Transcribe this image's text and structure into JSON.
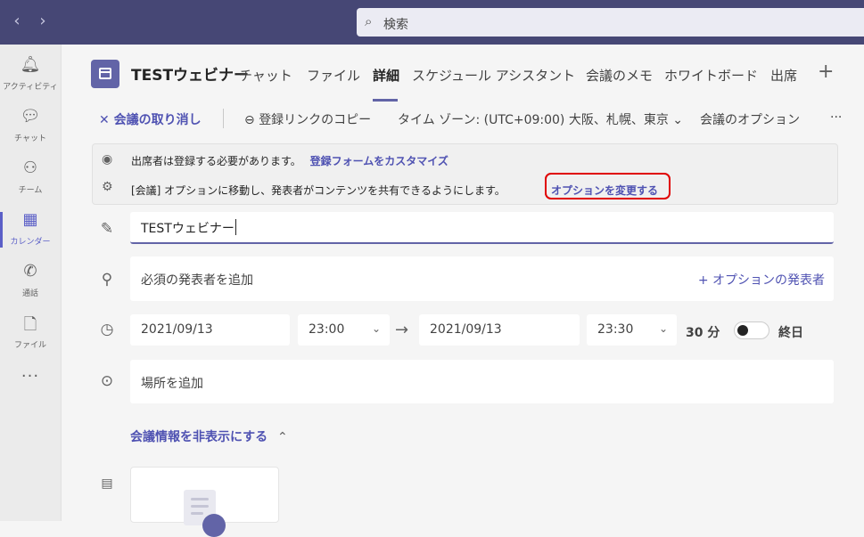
{
  "top_bar": {
    "back_icon": "chevron-left-icon",
    "forward_icon": "chevron-right-icon",
    "search_placeholder": "検索"
  },
  "rail": {
    "items": [
      {
        "label": "アクティビティ",
        "icon": "bell-icon"
      },
      {
        "label": "チャット",
        "icon": "chat-icon"
      },
      {
        "label": "チーム",
        "icon": "teams-icon"
      },
      {
        "label": "カレンダー",
        "icon": "calendar-icon"
      },
      {
        "label": "通話",
        "icon": "phone-icon"
      },
      {
        "label": "ファイル",
        "icon": "file-icon"
      }
    ],
    "active_index": 3,
    "more": "···"
  },
  "header": {
    "title": "TESTウェビナー",
    "tabs": [
      "チャット",
      "ファイル",
      "詳細",
      "スケジュール アシスタント",
      "会議のメモ",
      "ホワイトボード",
      "出席"
    ],
    "active_tab": "詳細",
    "add_tab": "+"
  },
  "actions": {
    "cancel": "会議の取り消し",
    "copy_link": "登録リンクのコピー",
    "timezone": "タイム ゾーン: (UTC+09:00) 大阪、札幌、東京",
    "meeting_options": "会議のオプション",
    "more": "···"
  },
  "banner": {
    "line1_text": "出席者は登録する必要があります。",
    "line1_link": "登録フォームをカスタマイズ",
    "line2_text": "[会議] オプションに移動し、発表者がコンテンツを共有できるようにします。",
    "line2_link": "オプションを変更する"
  },
  "form": {
    "title_value": "TESTウェビナー",
    "presenter_placeholder": "必須の発表者を追加",
    "optional_presenter": "+ オプションの発表者",
    "start_date": "2021/09/13",
    "start_time": "23:00",
    "end_date": "2021/09/13",
    "end_time": "23:30",
    "duration": "30 分",
    "all_day_label": "終日",
    "all_day_on": false,
    "location_placeholder": "場所を追加",
    "hide_info": "会議情報を非表示にする"
  },
  "colors": {
    "topbar": "#464775",
    "accent": "#6264a7",
    "link": "#4f52b2",
    "highlight": "#e00000"
  }
}
